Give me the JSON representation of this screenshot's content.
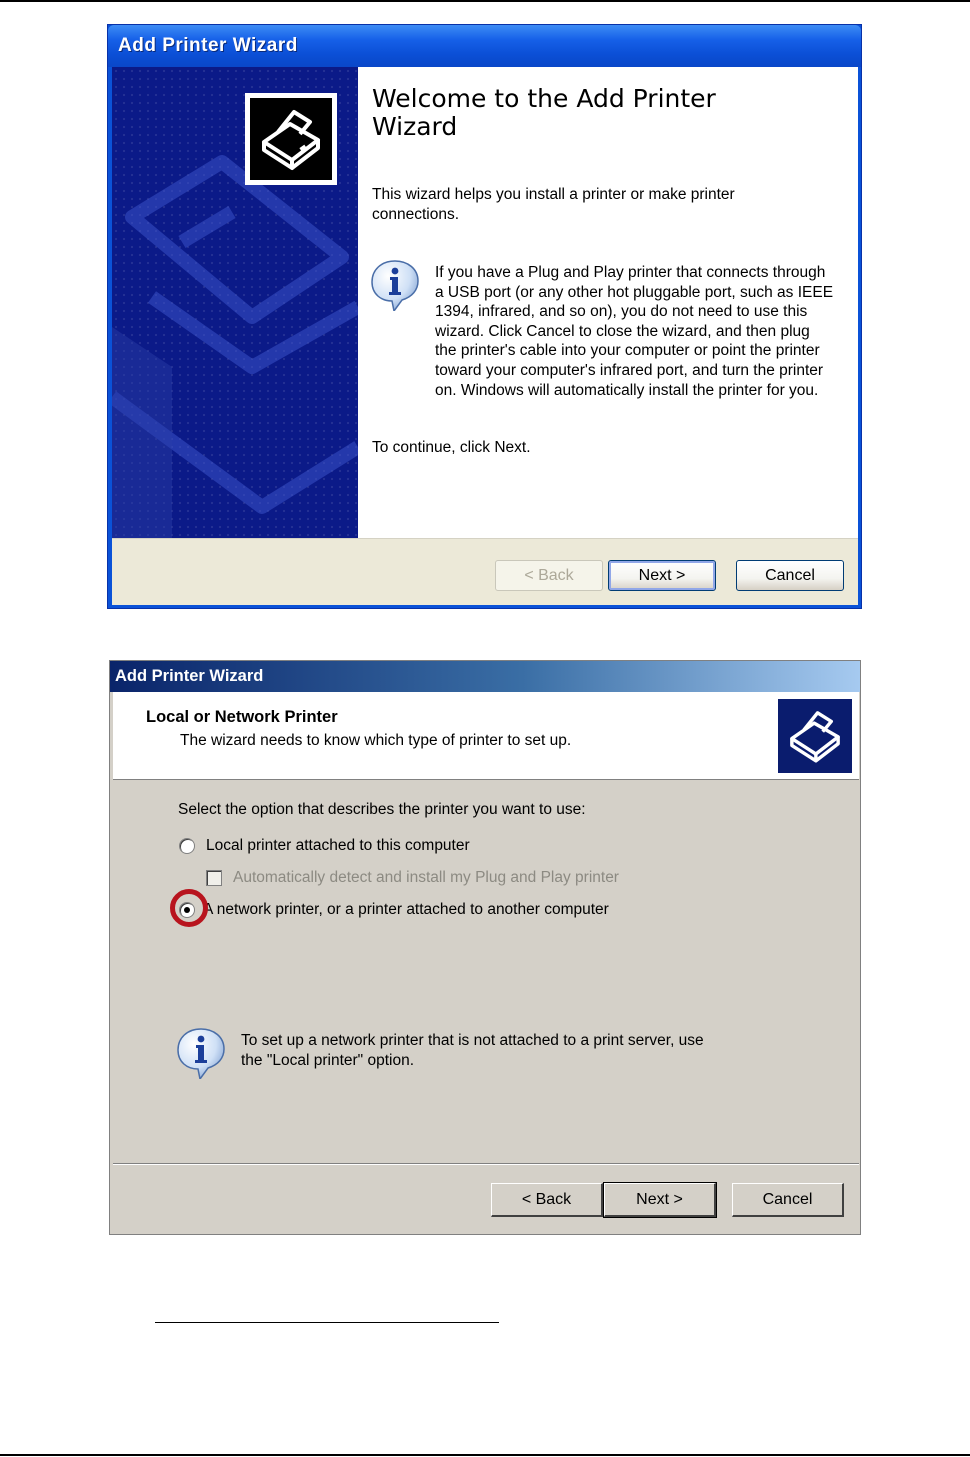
{
  "wizard1": {
    "title": "Add Printer Wizard",
    "heading": "Welcome to the Add Printer Wizard",
    "intro": "This wizard helps you install a printer or make printer connections.",
    "info": "If you have a Plug and Play printer that connects through a USB port (or any other hot pluggable port, such as IEEE 1394, infrared, and so on), you do not need to use this wizard. Click Cancel to close the wizard, and then plug the printer's cable into your computer or point the printer toward your computer's infrared port, and turn the printer on. Windows will automatically install the printer for you.",
    "continue": "To continue, click Next.",
    "buttons": {
      "back": "< Back",
      "next": "Next >",
      "cancel": "Cancel"
    }
  },
  "wizard2": {
    "title": "Add Printer Wizard",
    "header_title": "Local or Network Printer",
    "header_subtitle": "The wizard needs to know which type of printer to set up.",
    "prompt": "Select the option that describes the printer you want to use:",
    "options": {
      "local": "Local printer attached to this computer",
      "auto_detect": "Automatically detect and install my Plug and Play printer",
      "network": "A network printer, or a printer attached to another computer"
    },
    "selected_option": "network",
    "note": "To set up a network printer that is not attached to a print server, use the \"Local printer\" option.",
    "buttons": {
      "back": "< Back",
      "next": "Next >",
      "cancel": "Cancel"
    }
  },
  "icons": [
    "printer-icon",
    "info-icon"
  ],
  "colors": {
    "xp_title": "#0a52d8",
    "highlight_ring": "#b8141e",
    "classic_title": "#0a246a"
  }
}
